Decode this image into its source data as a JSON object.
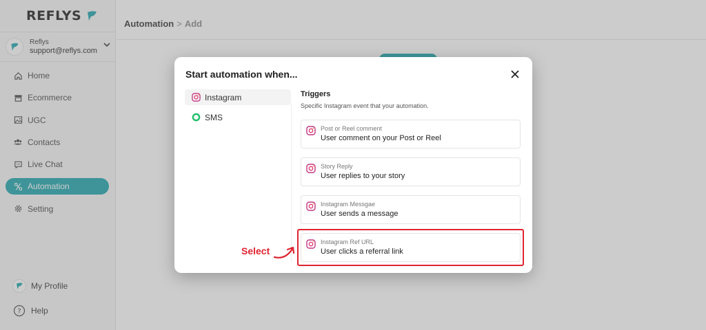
{
  "app": {
    "logo_text": "REFLYS"
  },
  "account": {
    "name": "Reflys",
    "email": "support@reflys.com"
  },
  "sidebar": {
    "items": [
      {
        "label": "Home",
        "icon": "home-icon",
        "active": false
      },
      {
        "label": "Ecommerce",
        "icon": "store-icon",
        "active": false
      },
      {
        "label": "UGC",
        "icon": "image-icon",
        "active": false
      },
      {
        "label": "Contacts",
        "icon": "users-icon",
        "active": false
      },
      {
        "label": "Live Chat",
        "icon": "chat-icon",
        "active": false
      },
      {
        "label": "Automation",
        "icon": "automation-icon",
        "active": true
      },
      {
        "label": "Setting",
        "icon": "gear-icon",
        "active": false
      }
    ],
    "profile_label": "My Profile",
    "help_label": "Help"
  },
  "breadcrumb": {
    "parent": "Automation",
    "separator": ">",
    "current": "Add"
  },
  "modal": {
    "title": "Start automation when...",
    "channels": [
      {
        "label": "Instagram",
        "icon": "instagram-icon",
        "active": true
      },
      {
        "label": "SMS",
        "icon": "sms-ring-icon",
        "active": false
      }
    ],
    "triggers_title": "Triggers",
    "triggers_subtitle": "Specific Instagram event that your automation.",
    "triggers": [
      {
        "caption": "Post or Reel comment",
        "label": "User comment on your Post or Reel"
      },
      {
        "caption": "Story Reply",
        "label": "User replies to your story"
      },
      {
        "caption": "Instagram Messgae",
        "label": "User sends a message"
      },
      {
        "caption": "Instagram Ref URL",
        "label": "User clicks a referral link",
        "highlighted": true
      }
    ]
  },
  "annotation": {
    "label": "Select"
  },
  "colors": {
    "accent": "#1aa5ad",
    "highlight": "#e0232f",
    "instagram": "#c13584"
  }
}
